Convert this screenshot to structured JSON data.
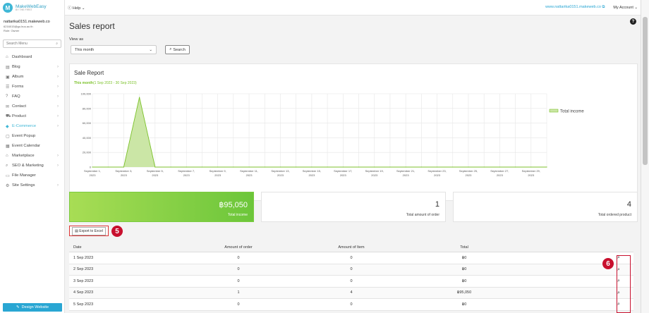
{
  "logo": {
    "name": "MakeWebEasy",
    "tagline": "BY THE FIRST"
  },
  "account": {
    "site": "nattarika0151.makeweb.co",
    "email": "6216015@go.buu.ac.th",
    "role": "Role: Owner"
  },
  "sidebar": {
    "search_placeholder": "Search Menu",
    "items": [
      {
        "label": "Dashboard",
        "icon": "home-icon",
        "arrow": ""
      },
      {
        "label": "Blog",
        "icon": "document-icon",
        "arrow": "›"
      },
      {
        "label": "Album",
        "icon": "image-icon",
        "arrow": "›"
      },
      {
        "label": "Forms",
        "icon": "list-icon",
        "arrow": "›"
      },
      {
        "label": "FAQ",
        "icon": "question-icon",
        "arrow": "›"
      },
      {
        "label": "Contact",
        "icon": "mail-icon",
        "arrow": "›"
      },
      {
        "label": "Product",
        "icon": "cart-icon",
        "arrow": "›"
      },
      {
        "label": "E-Commerce",
        "icon": "tag-icon",
        "arrow": "›"
      },
      {
        "label": "Event Popup",
        "icon": "popup-icon",
        "arrow": ""
      },
      {
        "label": "Event Calendar",
        "icon": "calendar-icon",
        "arrow": ""
      },
      {
        "label": "Marketplace",
        "icon": "store-icon",
        "arrow": "›"
      },
      {
        "label": "SEO & Marketing",
        "icon": "search-icon",
        "arrow": "›"
      },
      {
        "label": "File Manager",
        "icon": "folder-icon",
        "arrow": ""
      },
      {
        "label": "Site Settings",
        "icon": "gear-icon",
        "arrow": "›"
      }
    ],
    "design_button": "Design Website"
  },
  "topbar": {
    "help": "Help",
    "site_link": "www.nattarika0151.makeweb.co",
    "my_account": "My Account"
  },
  "page": {
    "title": "Sales report",
    "view_as_label": "View as",
    "view_as_value": "This month",
    "search_label": "Search"
  },
  "chart": {
    "title": "Sale Report",
    "range_bold": "This month",
    "range_text": "(1 Sep 2023 - 30 Sep 2023)",
    "colors": {
      "line": "#7cc22b",
      "fill": "#cbe6a6",
      "grid": "#e6e6e6"
    },
    "tick_labels": [
      [
        "September 1,",
        "2023"
      ],
      [
        "September 3,",
        "2023"
      ],
      [
        "September 5,",
        "2023"
      ],
      [
        "September 7,",
        "2023"
      ],
      [
        "September 9,",
        "2023"
      ],
      [
        "September 11,",
        "2023"
      ],
      [
        "September 13,",
        "2023"
      ],
      [
        "September 15,",
        "2023"
      ],
      [
        "September 17,",
        "2023"
      ],
      [
        "September 19,",
        "2023"
      ],
      [
        "September 21,",
        "2023"
      ],
      [
        "September 23,",
        "2023"
      ],
      [
        "September 25,",
        "2023"
      ],
      [
        "September 27,",
        "2023"
      ],
      [
        "September 29,",
        "2023"
      ]
    ],
    "y_tick_labels": [
      "100,000",
      "80,000",
      "60,000",
      "40,000",
      "20,000",
      "0"
    ]
  },
  "chart_data": {
    "type": "area",
    "title": "Sale Report",
    "subtitle": "This month(1 Sep 2023 - 30 Sep 2023)",
    "xlabel": "",
    "ylabel": "",
    "x": [
      1,
      2,
      3,
      4,
      5,
      6,
      7,
      8,
      9,
      10,
      11,
      12,
      13,
      14,
      15,
      16,
      17,
      18,
      19,
      20,
      21,
      22,
      23,
      24,
      25,
      26,
      27,
      28,
      29,
      30
    ],
    "series": [
      {
        "name": "Total income",
        "values": [
          0,
          0,
          0,
          95050,
          0,
          0,
          0,
          0,
          0,
          0,
          0,
          0,
          0,
          0,
          0,
          0,
          0,
          0,
          0,
          0,
          0,
          0,
          0,
          0,
          0,
          0,
          0,
          0,
          0,
          0
        ]
      }
    ],
    "ylim": [
      0,
      100000
    ],
    "grid": true,
    "legend": "top-right"
  },
  "stats": [
    {
      "value": "฿95,050",
      "label": "Total income"
    },
    {
      "value": "1",
      "label": "Total amount of order"
    },
    {
      "value": "4",
      "label": "Total ordered product"
    }
  ],
  "export_label": "Export to Excel",
  "badges": {
    "five": "5",
    "six": "6"
  },
  "table": {
    "headers": [
      "Date",
      "Amount of order",
      "Amount of Item",
      "Total"
    ],
    "rows": [
      [
        "1 Sep 2023",
        "0",
        "0",
        "฿0"
      ],
      [
        "2 Sep 2023",
        "0",
        "0",
        "฿0"
      ],
      [
        "3 Sep 2023",
        "0",
        "0",
        "฿0"
      ],
      [
        "4 Sep 2023",
        "1",
        "4",
        "฿95,050"
      ],
      [
        "5 Sep 2023",
        "0",
        "0",
        "฿0"
      ]
    ]
  }
}
